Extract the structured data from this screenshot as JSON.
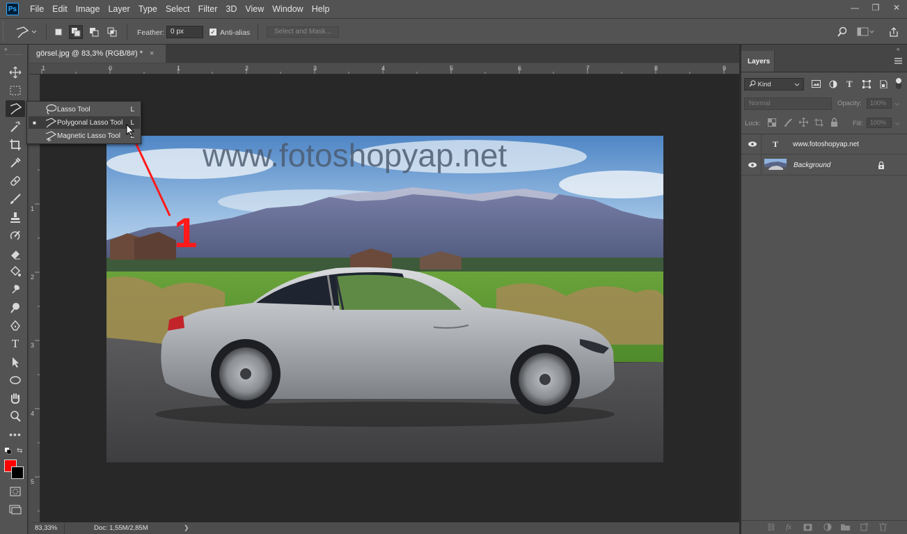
{
  "app": {
    "logo": "Ps"
  },
  "menu": [
    "File",
    "Edit",
    "Image",
    "Layer",
    "Type",
    "Select",
    "Filter",
    "3D",
    "View",
    "Window",
    "Help"
  ],
  "window_controls": {
    "minimize": "—",
    "restore": "❐",
    "close": "✕"
  },
  "options_bar": {
    "feather_label": "Feather:",
    "feather_value": "0 px",
    "antialias_label": "Anti-alias",
    "antialias_checked": true,
    "select_mask_label": "Select and Mask..."
  },
  "document": {
    "tab_title": "görsel.jpg @ 83,3% (RGB/8#) *",
    "close": "×",
    "ruler_h": [
      "1",
      "0",
      "1",
      "2",
      "3",
      "4",
      "5",
      "6",
      "7",
      "8",
      "9"
    ],
    "ruler_v": [
      "1",
      "2",
      "3",
      "4",
      "5"
    ],
    "watermark": "www.fotoshopyap.net",
    "annotation_number": "1",
    "annotation_color": "#ff1a1a"
  },
  "status": {
    "zoom": "83,33%",
    "doc": "Doc: 1,55M/2,85M",
    "arrow": "❯"
  },
  "tool_flyout": {
    "items": [
      {
        "label": "Lasso Tool",
        "key": "L",
        "selected": false,
        "icon": "lasso-icon"
      },
      {
        "label": "Polygonal Lasso Tool",
        "key": "L",
        "selected": true,
        "icon": "polygonal-lasso-icon"
      },
      {
        "label": "Magnetic Lasso Tool",
        "key": "L",
        "selected": false,
        "icon": "magnetic-lasso-icon"
      }
    ]
  },
  "colors": {
    "foreground": "#ff0000",
    "background": "#000000",
    "accent": "#31a8ff"
  },
  "layers_panel": {
    "tab": "Layers",
    "filter_kind": "Kind",
    "blend_mode": "Normal",
    "opacity_label": "Opacity:",
    "opacity_value": "100%",
    "lock_label": "Lock:",
    "fill_label": "Fill:",
    "fill_value": "100%",
    "layers": [
      {
        "name": "www.fotoshopyap.net",
        "type": "text",
        "type_glyph": "T",
        "visible": true
      },
      {
        "name": "Background",
        "type": "image",
        "visible": true,
        "locked": true
      }
    ]
  }
}
